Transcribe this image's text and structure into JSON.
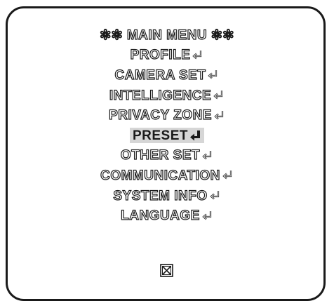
{
  "menu": {
    "title": "✻✻ MAIN MENU ✻✻",
    "items": [
      {
        "label": "PROFILE",
        "icon": "enter-icon",
        "selected": false
      },
      {
        "label": "CAMERA SET",
        "icon": "enter-icon",
        "selected": false
      },
      {
        "label": "INTELLIGENCE",
        "icon": "enter-icon",
        "selected": false
      },
      {
        "label": "PRIVACY ZONE",
        "icon": "enter-icon",
        "selected": false
      },
      {
        "label": "PRESET",
        "icon": "enter-icon",
        "selected": true
      },
      {
        "label": "OTHER SET",
        "icon": "enter-icon",
        "selected": false
      },
      {
        "label": "COMMUNICATION",
        "icon": "enter-icon",
        "selected": false
      },
      {
        "label": "SYSTEM INFO",
        "icon": "enter-icon",
        "selected": false
      },
      {
        "label": "LANGUAGE",
        "icon": "enter-icon",
        "selected": false
      }
    ],
    "exit_icon": "close-box-icon"
  },
  "colors": {
    "outline": "#1a1a1a",
    "selected_bg": "#d6d6d6",
    "text_fill": "#ffffff"
  }
}
